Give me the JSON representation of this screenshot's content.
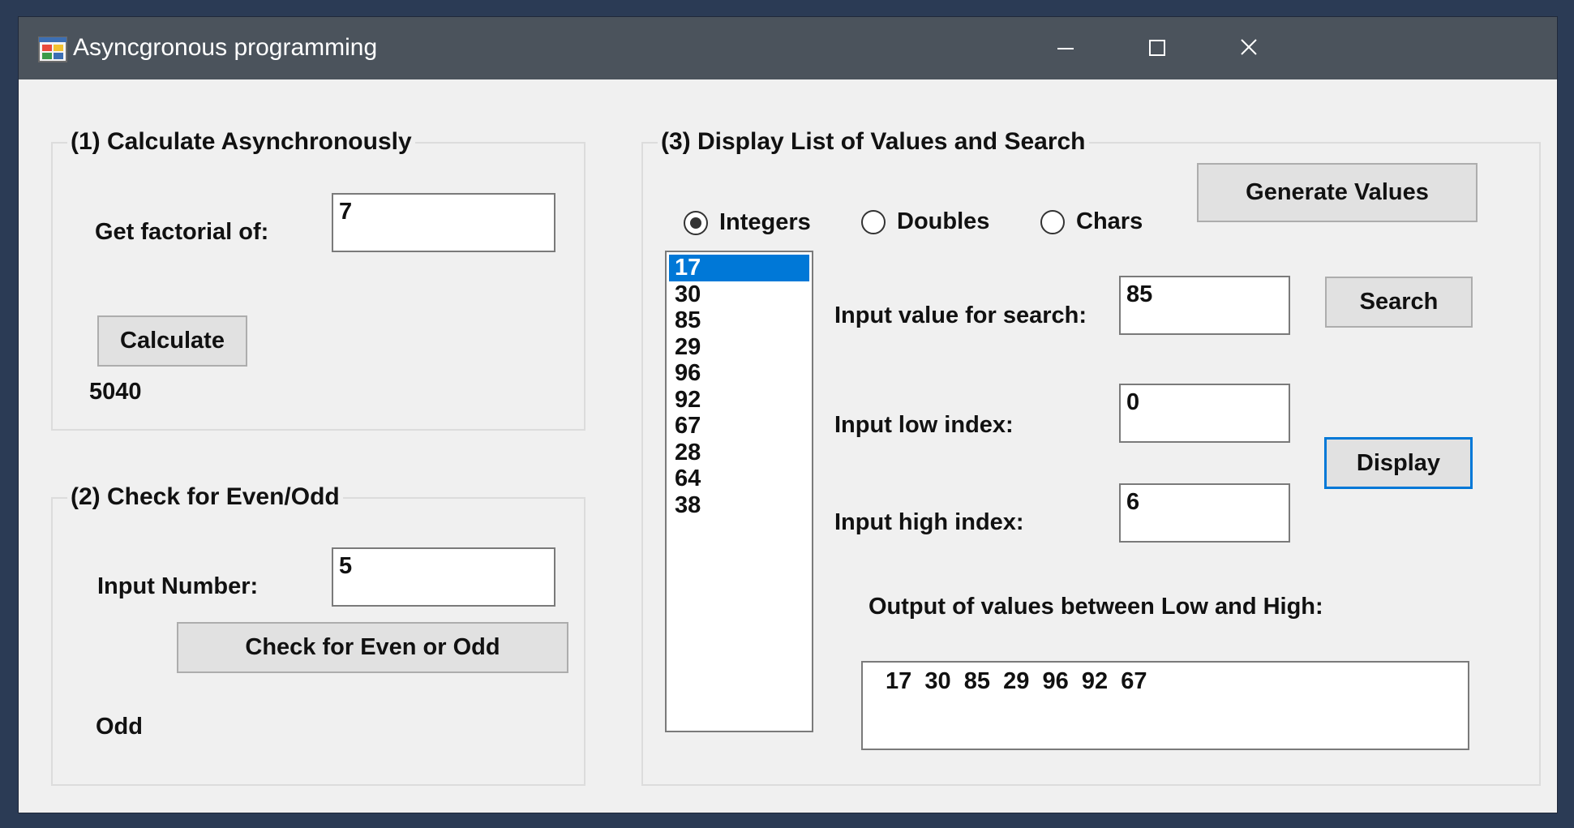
{
  "window": {
    "title": "Asyncgronous programming",
    "icons": {
      "app": "app-form-icon",
      "minimize": "minimize-icon",
      "maximize": "maximize-icon",
      "close": "close-icon"
    }
  },
  "group1": {
    "legend": "(1) Calculate Asynchronously",
    "factorial_label": "Get factorial of:",
    "factorial_value": "7",
    "calculate_label": "Calculate",
    "result": "5040"
  },
  "group2": {
    "legend": "(2) Check for Even/Odd",
    "input_label": "Input Number:",
    "input_value": "5",
    "check_label": "Check for Even or Odd",
    "result": "Odd"
  },
  "group3": {
    "legend": "(3) Display List of Values and Search",
    "radios": [
      {
        "label": "Integers",
        "checked": true
      },
      {
        "label": "Doubles",
        "checked": false
      },
      {
        "label": "Chars",
        "checked": false
      }
    ],
    "generate_label": "Generate Values",
    "list_items": [
      "17",
      "30",
      "85",
      "29",
      "96",
      "92",
      "67",
      "28",
      "64",
      "38"
    ],
    "selected_index": 0,
    "search_label": "Input value for search:",
    "search_value": "85",
    "search_button": "Search",
    "low_label": "Input low index:",
    "low_value": "0",
    "high_label": "Input high index:",
    "high_value": "6",
    "display_button": "Display",
    "output_label": "Output of values between Low and High:",
    "output_value": "17  30  85  29  96  92  67"
  },
  "colors": {
    "titlebar": "#4b535c",
    "accent": "#0078d7",
    "client": "#f0f0f0"
  }
}
